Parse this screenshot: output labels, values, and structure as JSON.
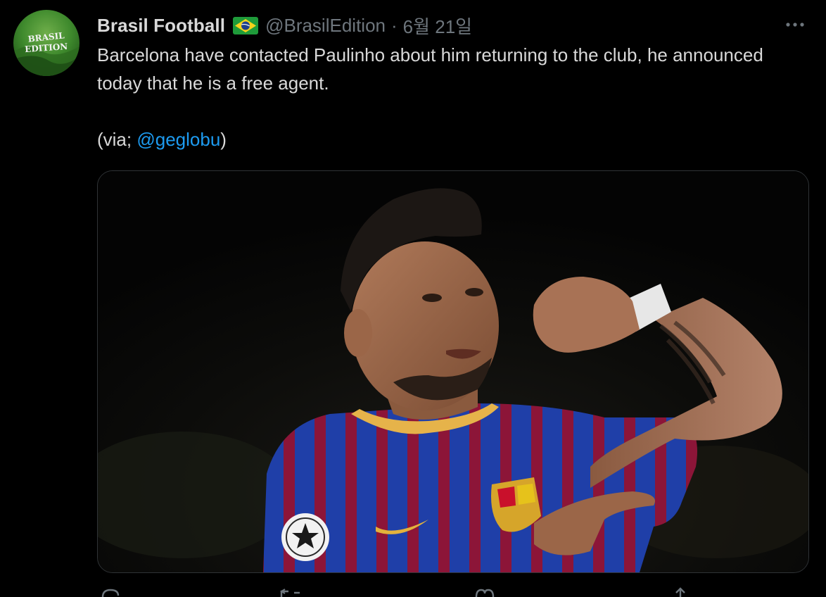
{
  "tweet": {
    "author": {
      "display_name": "Brasil Football",
      "handle": "@BrasilEdition",
      "avatar_text_line1": "BRASIL",
      "avatar_text_line2": "EDITION",
      "flag_icon": "brazil-flag-icon"
    },
    "separator": "·",
    "date": "6월 21일",
    "more_icon": "more-icon",
    "text": {
      "line1": "Barcelona have contacted Paulinho about him returning to the club, he announced today that he is a free agent.",
      "via_prefix": "(via; ",
      "mention": "@geglobu",
      "via_suffix": ")"
    },
    "media": {
      "description_icon": "photo-image"
    },
    "actions": [
      "reply-icon",
      "retweet-icon",
      "like-icon",
      "share-icon"
    ]
  },
  "colors": {
    "background": "#000000",
    "text": "#d9d9d9",
    "secondary": "#6e767d",
    "link": "#1d9bf0",
    "border": "#2f3336"
  }
}
